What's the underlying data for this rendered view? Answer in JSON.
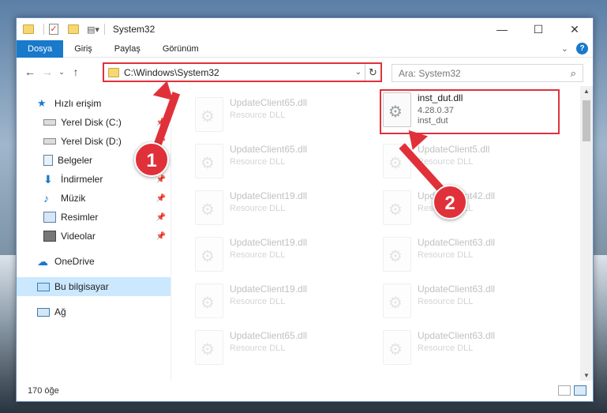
{
  "window": {
    "title": "System32",
    "controls": {
      "minimize": "—",
      "maximize": "☐",
      "close": "✕"
    }
  },
  "ribbon": {
    "tabs": [
      {
        "label": "Dosya",
        "active": true
      },
      {
        "label": "Giriş"
      },
      {
        "label": "Paylaş"
      },
      {
        "label": "Görünüm"
      }
    ]
  },
  "address": {
    "path": "C:\\Windows\\System32",
    "search_placeholder": "Ara: System32"
  },
  "sidebar": {
    "items": [
      {
        "label": "Hızlı erişim",
        "icon": "star-icon",
        "pinned": false
      },
      {
        "label": "Yerel Disk (C:)",
        "icon": "drive-icon",
        "pinned": true
      },
      {
        "label": "Yerel Disk (D:)",
        "icon": "drive-icon",
        "pinned": true
      },
      {
        "label": "Belgeler",
        "icon": "documents-icon",
        "pinned": true
      },
      {
        "label": "İndirmeler",
        "icon": "download-icon",
        "pinned": true
      },
      {
        "label": "Müzik",
        "icon": "music-icon",
        "pinned": true
      },
      {
        "label": "Resimler",
        "icon": "pictures-icon",
        "pinned": true
      },
      {
        "label": "Videolar",
        "icon": "videos-icon",
        "pinned": true
      },
      {
        "label": "OneDrive",
        "icon": "cloud-icon"
      },
      {
        "label": "Bu bilgisayar",
        "icon": "computer-icon",
        "selected": true
      },
      {
        "label": "Ağ",
        "icon": "network-icon"
      }
    ]
  },
  "files": {
    "highlighted": {
      "name": "inst_dut.dll",
      "version": "4.28.0.37",
      "description": "inst_dut"
    },
    "ghost_left": [
      {
        "name": "UpdateClient65.dll",
        "type": "Resource DLL"
      },
      {
        "name": "UpdateClient65.dll",
        "type": "Resource DLL"
      },
      {
        "name": "UpdateClient19.dll",
        "type": "Resource DLL"
      },
      {
        "name": "UpdateClient19.dll",
        "type": "Resource DLL"
      },
      {
        "name": "UpdateClient19.dll",
        "type": "Resource DLL"
      },
      {
        "name": "UpdateClient65.dll",
        "type": "Resource DLL"
      }
    ],
    "ghost_right": [
      {
        "name": "UpdateClient5.dll",
        "type": "Resource DLL"
      },
      {
        "name": "UpdateClient42.dll",
        "type": "Resource DLL"
      },
      {
        "name": "UpdateClient63.dll",
        "type": "Resource DLL"
      },
      {
        "name": "UpdateClient63.dll",
        "type": "Resource DLL"
      },
      {
        "name": "UpdateClient63.dll",
        "type": "Resource DLL"
      }
    ]
  },
  "status": {
    "count": "170 öğe"
  },
  "annotations": {
    "step1": "1",
    "step2": "2"
  },
  "colors": {
    "accent": "#1979ca",
    "annotation": "#e0313a"
  }
}
